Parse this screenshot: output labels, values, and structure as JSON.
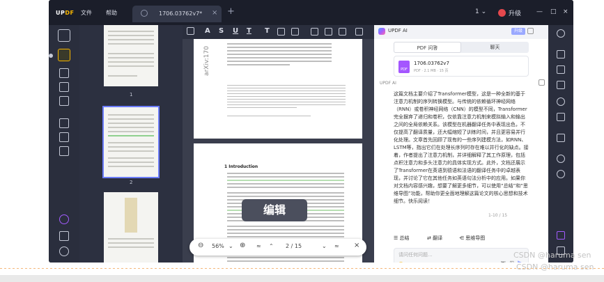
{
  "colors": {
    "accent": "#f7b500",
    "ai_accent": "#9aa8ff",
    "upgrade": "#e5484d"
  },
  "titlebar": {
    "logo_a": "UP",
    "logo_b": "DF",
    "menu_file": "文件",
    "menu_help": "帮助",
    "tab_title": "1706.03762v7*",
    "tab_close": "×",
    "tab_add": "+",
    "version": "1 ⌄",
    "upgrade": "升级",
    "minimize": "—",
    "maximize": "□",
    "close": "×"
  },
  "thumbnails": {
    "page1": "1",
    "page2": "2"
  },
  "toolbar": {
    "tools": [
      "A",
      "S",
      "U",
      "T",
      "T"
    ]
  },
  "document": {
    "arxiv": "arXiv:170",
    "intro_heading": "1 Introduction",
    "edit_label": "编辑"
  },
  "zoombar": {
    "minus": "⊖",
    "zoom": "56%",
    "zoom_caret": "⌄",
    "plus": "⊕",
    "page_indicator": "2 / 15",
    "close": "×"
  },
  "ai_panel": {
    "title": "UPDF AI",
    "badge": "升级",
    "tabs": [
      "PDF 问答",
      "聊天"
    ],
    "file_name": "1706.03762v7",
    "file_meta": "PDF · 2.1 MB · 15 页",
    "pdf_icon_text": "PDF",
    "section_label": "UPDF AI",
    "answer": "这篇文档主要介绍了Transformer模型，这是一种全新的基于注意力机制的序列转换模型。与传统的依赖循环神经网络（RNN）或卷积神经网络（CNN）的模型不同，Transformer完全摒弃了递归和卷积，仅依靠注意力机制来模拟输入和输出之间的全局依赖关系。该模型在机器翻译任务中表现出色，不仅提高了翻译质量，还大幅缩短了训练时间，并且更容易并行化处理。文章首先回顾了现有的一些序列建模方法，如RNN、LSTM等，指出它们在处理长序列时存在难以并行化的缺点。接着，作者提出了注意力机制，并详细解释了其工作原理，包括点积注意力和多头注意力的具体实现方式。此外，文档还展示了Transformer在英语到德语和法语的翻译任务中的卓越表现，并讨论了它在其他任务如英语句法分析中的应用。如果你对文档内容感兴趣，想要了解更多细节，可以使用“总结”和“思维导图”功能，帮助你更全面地理解这篇论文的核心思想和技术细节。快乐阅读！",
    "count": "1-10 / 15",
    "chips": [
      "总结",
      "翻译",
      "思维导图"
    ],
    "input_placeholder": "请问任何问题..."
  },
  "watermark": "CSDN @haruma sen"
}
